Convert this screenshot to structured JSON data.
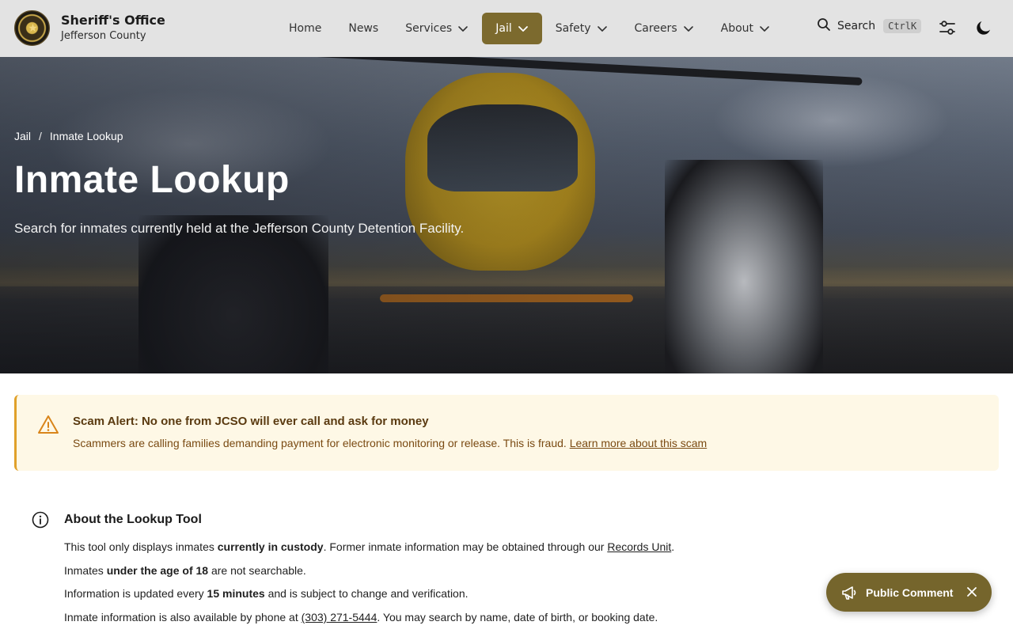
{
  "header": {
    "brand_title": "Sheriff's Office",
    "brand_subtitle": "Jefferson County",
    "logo_icon": "sheriff-badge-logo",
    "nav": [
      {
        "label": "Home",
        "dropdown": false,
        "active": false
      },
      {
        "label": "News",
        "dropdown": false,
        "active": false
      },
      {
        "label": "Services",
        "dropdown": true,
        "active": false
      },
      {
        "label": "Jail",
        "dropdown": true,
        "active": true
      },
      {
        "label": "Safety",
        "dropdown": true,
        "active": false
      },
      {
        "label": "Careers",
        "dropdown": true,
        "active": false
      },
      {
        "label": "About",
        "dropdown": true,
        "active": false
      }
    ],
    "search_label": "Search",
    "search_shortcut": "CtrlK",
    "icons": [
      "search-icon",
      "settings-sliders-icon",
      "dark-mode-moon-icon"
    ]
  },
  "hero": {
    "breadcrumb": [
      "Jail",
      "Inmate Lookup"
    ],
    "breadcrumb_separator": "/",
    "title": "Inmate Lookup",
    "subtitle": "Search for inmates currently held at the Jefferson County Detention Facility."
  },
  "alert": {
    "title": "Scam Alert: No one from JCSO will ever call and ask for money",
    "body": "Scammers are calling families demanding payment for electronic monitoring or release. This is fraud.",
    "link_label": "Learn more about this scam",
    "icon": "warning-triangle-icon"
  },
  "about": {
    "title": "About the Lookup Tool",
    "icon": "info-circle-icon",
    "line1_pre": "This tool only displays inmates ",
    "line1_bold": "currently in custody",
    "line1_mid": ". Former inmate information may be obtained through our ",
    "line1_link": "Records Unit",
    "line1_post": ".",
    "line2_pre": "Inmates ",
    "line2_bold": "under the age of 18",
    "line2_post": " are not searchable.",
    "line3_pre": "Information is updated every ",
    "line3_bold": "15 minutes",
    "line3_post": " and is subject to change and verification.",
    "line4_pre": "Inmate information is also available by phone at ",
    "line4_link": "(303) 271-5444",
    "line4_post": ". You may search by name, date of birth, or booking date."
  },
  "public_comment": {
    "label": "Public Comment",
    "icon": "megaphone-icon",
    "close_icon": "close-icon"
  },
  "colors": {
    "header_bg": "#e3e3e3",
    "accent": "#7c6a2e",
    "alert_bg": "#fef8e6",
    "alert_border": "#e0a12a",
    "alert_text": "#7a4a12"
  }
}
